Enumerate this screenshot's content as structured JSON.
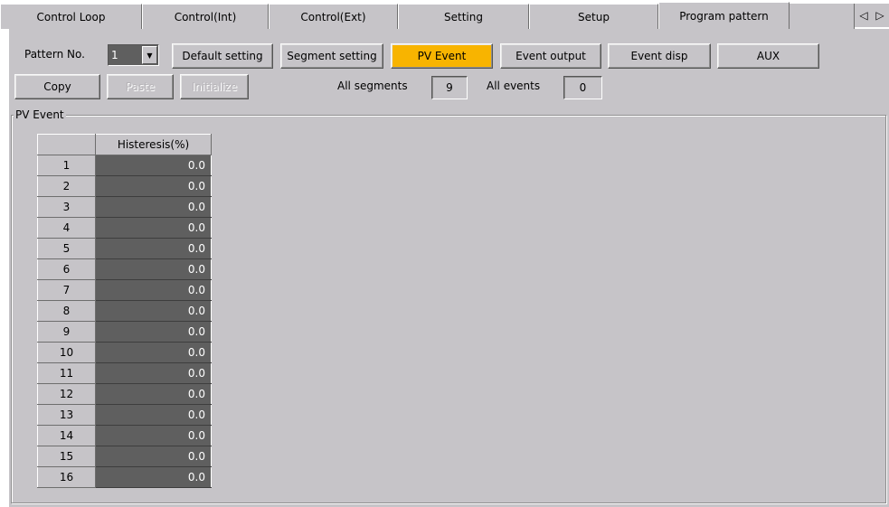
{
  "tabs": [
    {
      "label": "Control Loop",
      "active": false
    },
    {
      "label": "Control(Int)",
      "active": false
    },
    {
      "label": "Control(Ext)",
      "active": false
    },
    {
      "label": "Setting",
      "active": false
    },
    {
      "label": "Setup",
      "active": false
    },
    {
      "label": "Program pattern",
      "active": true
    }
  ],
  "toolbar": {
    "pattern_label": "Pattern No.",
    "pattern_value": "1",
    "buttons": {
      "default_setting": "Default setting",
      "segment_setting": "Segment setting",
      "pv_event": "PV Event",
      "event_output": "Event output",
      "event_disp": "Event disp",
      "aux": "AUX",
      "copy": "Copy",
      "paste": "Paste",
      "initialize": "Initialize"
    },
    "all_segments_label": "All segments",
    "all_segments_value": "9",
    "all_events_label": "All events",
    "all_events_value": "0"
  },
  "group": {
    "title": "PV Event",
    "column_header": "Histeresis(%)",
    "rows": [
      {
        "no": "1",
        "value": "0.0"
      },
      {
        "no": "2",
        "value": "0.0"
      },
      {
        "no": "3",
        "value": "0.0"
      },
      {
        "no": "4",
        "value": "0.0"
      },
      {
        "no": "5",
        "value": "0.0"
      },
      {
        "no": "6",
        "value": "0.0"
      },
      {
        "no": "7",
        "value": "0.0"
      },
      {
        "no": "8",
        "value": "0.0"
      },
      {
        "no": "9",
        "value": "0.0"
      },
      {
        "no": "10",
        "value": "0.0"
      },
      {
        "no": "11",
        "value": "0.0"
      },
      {
        "no": "12",
        "value": "0.0"
      },
      {
        "no": "13",
        "value": "0.0"
      },
      {
        "no": "14",
        "value": "0.0"
      },
      {
        "no": "15",
        "value": "0.0"
      },
      {
        "no": "16",
        "value": "0.0"
      }
    ]
  },
  "icons": {
    "prev": "triangle-left-icon",
    "next": "triangle-right-icon",
    "dropdown": "chevron-down-icon"
  },
  "colors": {
    "panel_bg": "#c6c4c8",
    "active_button": "#f8b400",
    "cell_bg": "#5f5f5f"
  }
}
